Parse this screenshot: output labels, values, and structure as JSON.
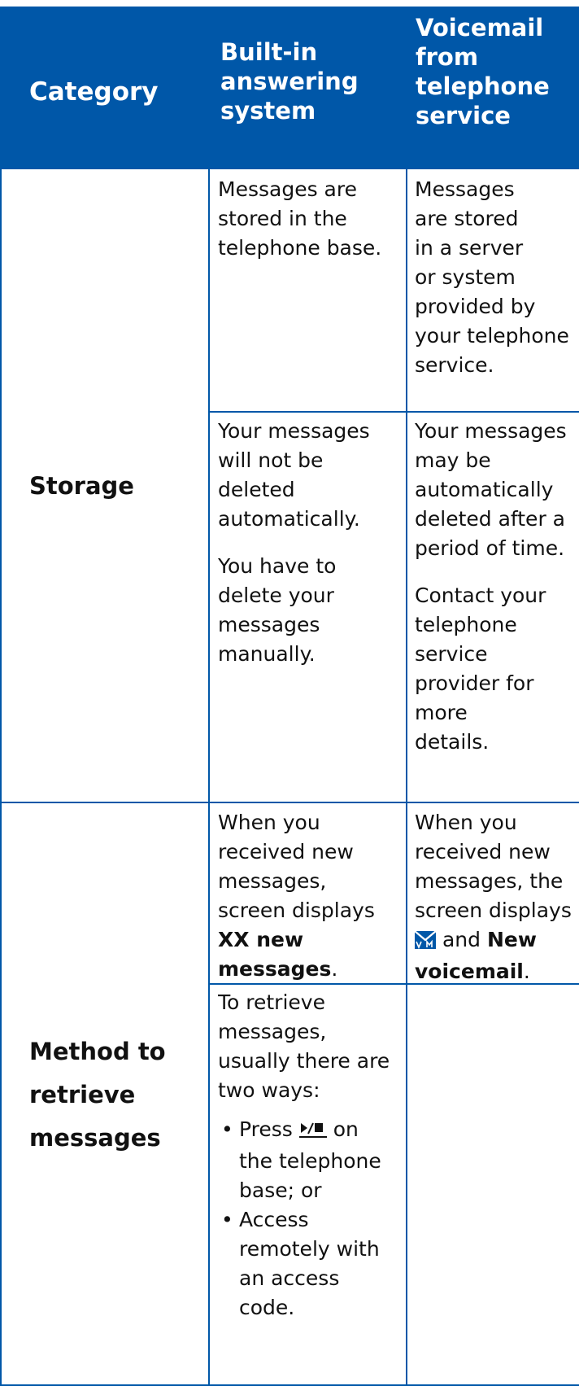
{
  "header": {
    "category": "Category",
    "builtin": [
      "Built-in",
      "answering",
      "system"
    ],
    "voicemail": [
      "Voicemail",
      "from",
      "telephone",
      "service"
    ]
  },
  "rows": {
    "storage": {
      "category": "Storage",
      "r1_builtin": [
        "Messages are",
        "stored in the",
        "telephone base."
      ],
      "r1_voicemail": [
        "Messages",
        "are stored",
        "in a server",
        "or system",
        "provided by",
        "your telephone",
        "service."
      ],
      "r2_builtin_a": [
        "Your messages",
        "will not be",
        "deleted",
        "automatically."
      ],
      "r2_builtin_b": [
        "You have to",
        "delete your",
        "messages",
        "manually."
      ],
      "r2_voicemail_a": [
        "Your messages",
        "may be",
        "automatically",
        "deleted after a",
        "period of time."
      ],
      "r2_voicemail_b": [
        "Contact your",
        "telephone",
        "service",
        "provider for",
        "more",
        "details."
      ]
    },
    "retrieve": {
      "category": [
        "Method to",
        "retrieve",
        "messages"
      ],
      "r1_builtin": [
        "When you",
        "received new",
        "messages,",
        "screen displays"
      ],
      "r1_builtin_bold": [
        "XX new",
        "messages"
      ],
      "r1_builtin_end": ".",
      "r1_voicemail": [
        "When you",
        "received new",
        "messages, the",
        "screen displays"
      ],
      "r1_voicemail_mid": "and",
      "r1_voicemail_bold": [
        "New",
        "voicemail"
      ],
      "r1_voicemail_end": ".",
      "r2_builtin_intro": [
        "To retrieve",
        "messages,",
        "usually there are",
        "two ways:"
      ],
      "bullet1_pre": "Press",
      "bullet1_rest": [
        "on",
        "the telephone",
        "base; or"
      ],
      "bullet2": [
        "Access",
        "remotely with",
        "an access",
        "code."
      ]
    }
  },
  "icons": {
    "voicemail": "voicemail-icon",
    "play_stop": "play-stop-icon"
  },
  "colors": {
    "header_bg": "#0057a8",
    "header_text": "#ffffff",
    "grid": "#0057a8"
  }
}
